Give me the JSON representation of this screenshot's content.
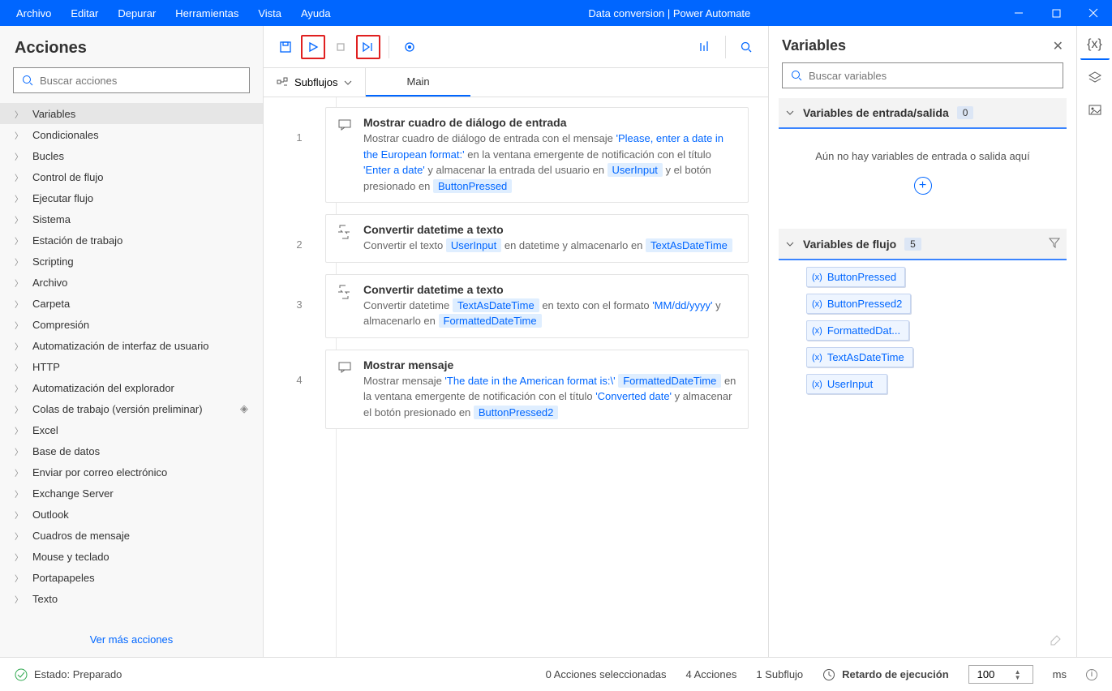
{
  "titlebar": {
    "menu": [
      "Archivo",
      "Editar",
      "Depurar",
      "Herramientas",
      "Vista",
      "Ayuda"
    ],
    "title": "Data conversion | Power Automate"
  },
  "left": {
    "header": "Acciones",
    "search_placeholder": "Buscar acciones",
    "items": [
      {
        "label": "Variables",
        "selected": true
      },
      {
        "label": "Condicionales"
      },
      {
        "label": "Bucles"
      },
      {
        "label": "Control de flujo"
      },
      {
        "label": "Ejecutar flujo"
      },
      {
        "label": "Sistema"
      },
      {
        "label": "Estación de trabajo"
      },
      {
        "label": "Scripting"
      },
      {
        "label": "Archivo"
      },
      {
        "label": "Carpeta"
      },
      {
        "label": "Compresión"
      },
      {
        "label": "Automatización de interfaz de usuario"
      },
      {
        "label": "HTTP"
      },
      {
        "label": "Automatización del explorador"
      },
      {
        "label": "Colas de trabajo (versión preliminar)",
        "diamond": true
      },
      {
        "label": "Excel"
      },
      {
        "label": "Base de datos"
      },
      {
        "label": "Enviar por correo electrónico"
      },
      {
        "label": "Exchange Server"
      },
      {
        "label": "Outlook"
      },
      {
        "label": "Cuadros de mensaje"
      },
      {
        "label": "Mouse y teclado"
      },
      {
        "label": "Portapapeles"
      },
      {
        "label": "Texto"
      }
    ],
    "see_more": "Ver más acciones"
  },
  "subflows": {
    "label": "Subflujos",
    "tab": "Main"
  },
  "steps": [
    {
      "num": "1",
      "icon": "message",
      "title": "Mostrar cuadro de diálogo de entrada",
      "parts": [
        {
          "t": "Mostrar cuadro de diálogo de entrada con el mensaje "
        },
        {
          "t": "'Please, enter a date in the European format:'",
          "c": "lit"
        },
        {
          "t": " en la ventana emergente de notificación con el título "
        },
        {
          "t": "'Enter a date'",
          "c": "lit"
        },
        {
          "t": " y almacenar la entrada del usuario en "
        },
        {
          "t": "UserInput",
          "c": "token"
        },
        {
          "t": " y el botón presionado en "
        },
        {
          "t": "ButtonPressed",
          "c": "token"
        }
      ]
    },
    {
      "num": "2",
      "icon": "convert",
      "title": "Convertir datetime a texto",
      "parts": [
        {
          "t": "Convertir el texto "
        },
        {
          "t": "UserInput",
          "c": "token"
        },
        {
          "t": " en datetime y almacenarlo en "
        },
        {
          "t": "TextAsDateTime",
          "c": "token"
        }
      ]
    },
    {
      "num": "3",
      "icon": "convert",
      "title": "Convertir datetime a texto",
      "parts": [
        {
          "t": "Convertir datetime "
        },
        {
          "t": "TextAsDateTime",
          "c": "token"
        },
        {
          "t": " en texto con el formato "
        },
        {
          "t": "'MM/dd/yyyy'",
          "c": "lit"
        },
        {
          "t": " y almacenarlo en "
        },
        {
          "t": "FormattedDateTime",
          "c": "token"
        }
      ]
    },
    {
      "num": "4",
      "icon": "message",
      "title": "Mostrar mensaje",
      "parts": [
        {
          "t": "Mostrar mensaje "
        },
        {
          "t": "'The date in the American format is:\\'",
          "c": "lit"
        },
        {
          "t": " "
        },
        {
          "t": "FormattedDateTime",
          "c": "token"
        },
        {
          "t": " en la ventana emergente de notificación con el título "
        },
        {
          "t": "'Converted date'",
          "c": "lit"
        },
        {
          "t": " y almacenar el botón presionado en "
        },
        {
          "t": "ButtonPressed2",
          "c": "token"
        }
      ]
    }
  ],
  "vars": {
    "header": "Variables",
    "search_placeholder": "Buscar variables",
    "io": {
      "title": "Variables de entrada/salida",
      "count": "0",
      "empty": "Aún no hay variables de entrada o salida aquí"
    },
    "flow": {
      "title": "Variables de flujo",
      "count": "5",
      "items": [
        "ButtonPressed",
        "ButtonPressed2",
        "FormattedDat...",
        "TextAsDateTime",
        "UserInput"
      ]
    }
  },
  "status": {
    "state": "Estado: Preparado",
    "selected": "0 Acciones seleccionadas",
    "actions": "4 Acciones",
    "subflow": "1 Subflujo",
    "delay_label": "Retardo de ejecución",
    "delay_value": "100",
    "ms": "ms"
  }
}
